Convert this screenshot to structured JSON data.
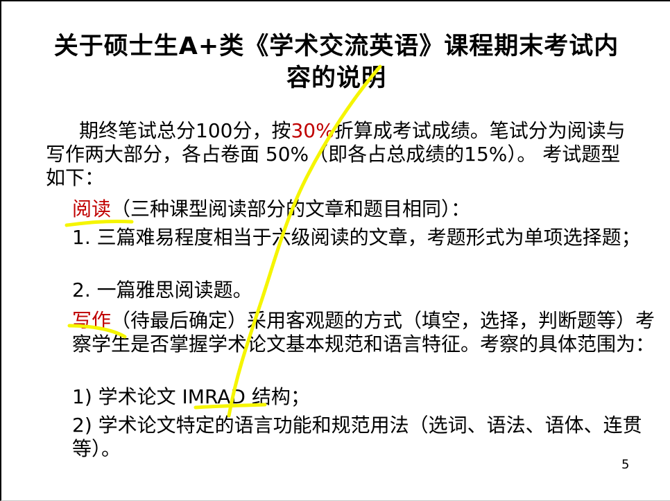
{
  "slide": {
    "title_line1": "关于硕士生A+类《学术交流英语》课程期末考试内",
    "title_line2": "容的说明",
    "intro_pre": "期终笔试总分100分，按",
    "intro_highlight": "30%",
    "intro_post": "折算成考试成绩。笔试分为阅读与写作两大部分，各占卷面 50%（即各占总成绩的15%）。 考试题型如下：",
    "reading_label": "阅读",
    "reading_desc": "（三种课型阅读部分的文章和题目相同）：",
    "reading_item1": "1. 三篇难易程度相当于六级阅读的文章，考题形式为单项选择题；",
    "reading_item2": "2. 一篇雅思阅读题。",
    "writing_label": "写作",
    "writing_desc": "（待最后确定）采用客观题的方式（填空，选择，判断题等）考察学生是否掌握学术论文基本规范和语言特征。考察的具体范围为：",
    "writing_item1": "1) 学术论文 IMRAD 结构；",
    "writing_item2": "2) 学术论文特定的语言功能和规范用法（选词、语法、语体、连贯等）。",
    "page_number": "5"
  },
  "colors": {
    "highlight_red": "#c00000",
    "annotation_yellow": "#f5f500"
  }
}
